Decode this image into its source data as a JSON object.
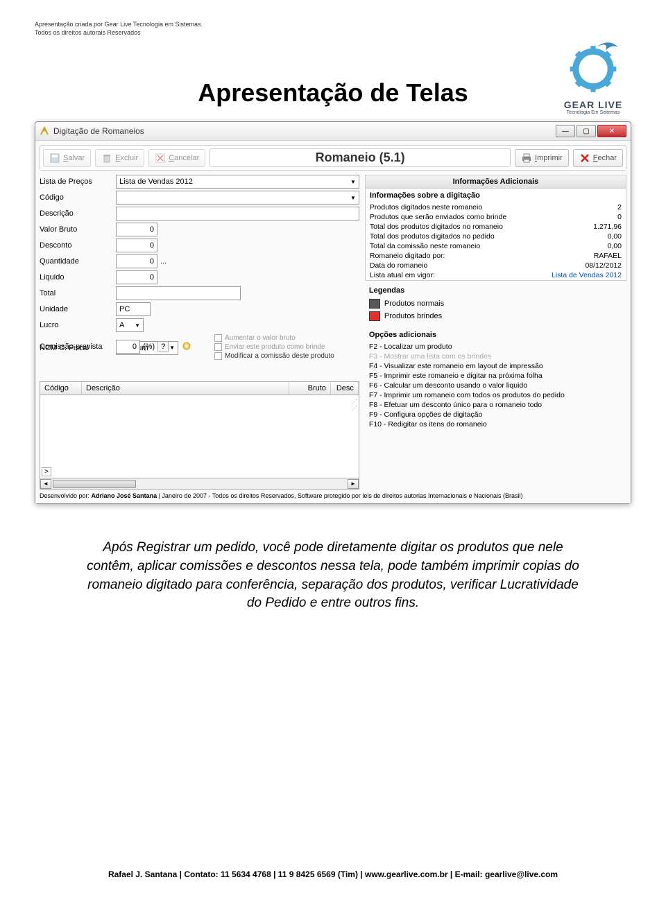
{
  "header": {
    "line1": "Apresentação criada por Gear Live Tecnologia em Sistemas.",
    "line2": "Todos os direitos autorais Reservados"
  },
  "logo": {
    "name": "GEAR LIVE",
    "tagline": "Tecnologia Em Sistemas"
  },
  "page_title": "Apresentação de Telas",
  "window": {
    "title": "Digitação de Romaneios",
    "toolbar": {
      "salvar": "Salvar",
      "excluir": "Excluir",
      "cancelar": "Cancelar",
      "main_label": "Romaneio (5.1)",
      "imprimir": "Imprimir",
      "fechar": "Fechar"
    },
    "form": {
      "lista_precos_label": "Lista de Preços",
      "lista_precos_value": "Lista de Vendas 2012",
      "codigo_label": "Código",
      "descricao_label": "Descrição",
      "valor_bruto_label": "Valor Bruto",
      "valor_bruto_value": "0",
      "desconto_label": "Desconto",
      "desconto_value": "0",
      "quantidade_label": "Quantidade",
      "quantidade_value": "0",
      "quantidade_suffix": "...",
      "liquido_label": "Liquido",
      "liquido_value": "0",
      "total_label": "Total",
      "unidade_label": "Unidade",
      "unidade_value": "PC",
      "lucro_label": "Lucro",
      "lucro_value": "A",
      "ncm_label": "NCM C. Fiscal",
      "ncm_value": "Nenhum",
      "comissao_label": "Comissão prevista",
      "comissao_value": "0",
      "comissao_unit": "(%)",
      "chk_aumentar": "Aumentar o valor bruto",
      "chk_brinde": "Enviar este produto como brinde",
      "chk_modificar": "Modificar a comissão deste produto"
    },
    "info": {
      "header": "Informações Adicionais",
      "sub_header": "Informações sobre a digitação",
      "rows": [
        {
          "label": "Produtos digitados neste romaneio",
          "value": "2"
        },
        {
          "label": "Produtos que serão enviados como brinde",
          "value": "0"
        },
        {
          "label": "Total dos produtos digitados no romaneio",
          "value": "1.271,96"
        },
        {
          "label": "Total dos produtos digitados no pedido",
          "value": "0,00"
        },
        {
          "label": "Total da comissão neste romaneio",
          "value": "0,00"
        },
        {
          "label": "Romaneio digitado por:",
          "value": "RAFAEL"
        },
        {
          "label": "Data do romaneio",
          "value": "08/12/2012"
        },
        {
          "label": "Lista atual em vigor:",
          "value": "Lista de Vendas 2012",
          "link": true
        }
      ],
      "legendas_header": "Legendas",
      "legend_normal": "Produtos normais",
      "legend_brinde": "Produtos brindes",
      "opcoes_header": "Opções adicionais",
      "shortcuts": [
        {
          "text": "F2 - Localizar um produto"
        },
        {
          "text": "F3 - Mostrar uma lista com os brindes",
          "disabled": true
        },
        {
          "text": "F4 - Visualizar este romaneio em layout de impressão"
        },
        {
          "text": "F5 - Imprimir este romaneio e digitar na próxima folha"
        },
        {
          "text": "F6 - Calcular um desconto usando o valor liquido"
        },
        {
          "text": "F7 - Imprimir um romaneio com todos os produtos do pedido"
        },
        {
          "text": "F8 - Efetuar um desconto único para o romaneio todo"
        },
        {
          "text": "F9 - Configura opções de digitação"
        },
        {
          "text": "F10 - Redigitar os itens do romaneio"
        }
      ]
    },
    "table": {
      "col_codigo": "Código",
      "col_descricao": "Descrição",
      "col_bruto": "Bruto",
      "col_desc": "Desc"
    },
    "dev_credit": {
      "prefix": "Desenvolvido por: ",
      "author": "Adriano José Santana",
      "suffix": " | Janeiro de 2007 - Todos os direitos Reservados, Software protegido por leis de direitos autorias Internacionais e Nacionais (Brasil)"
    }
  },
  "body_text": "Após Registrar um pedido, você pode diretamente digitar os produtos que nele contêm, aplicar comissões e descontos nessa tela, pode também imprimir copias do romaneio digitado para conferência, separação dos produtos, verificar Lucratividade do Pedido e entre outros fins.",
  "footer": "Rafael J. Santana | Contato: 11 5634 4768 | 11 9 8425 6569 (Tim) | www.gearlive.com.br | E-mail: gearlive@live.com"
}
